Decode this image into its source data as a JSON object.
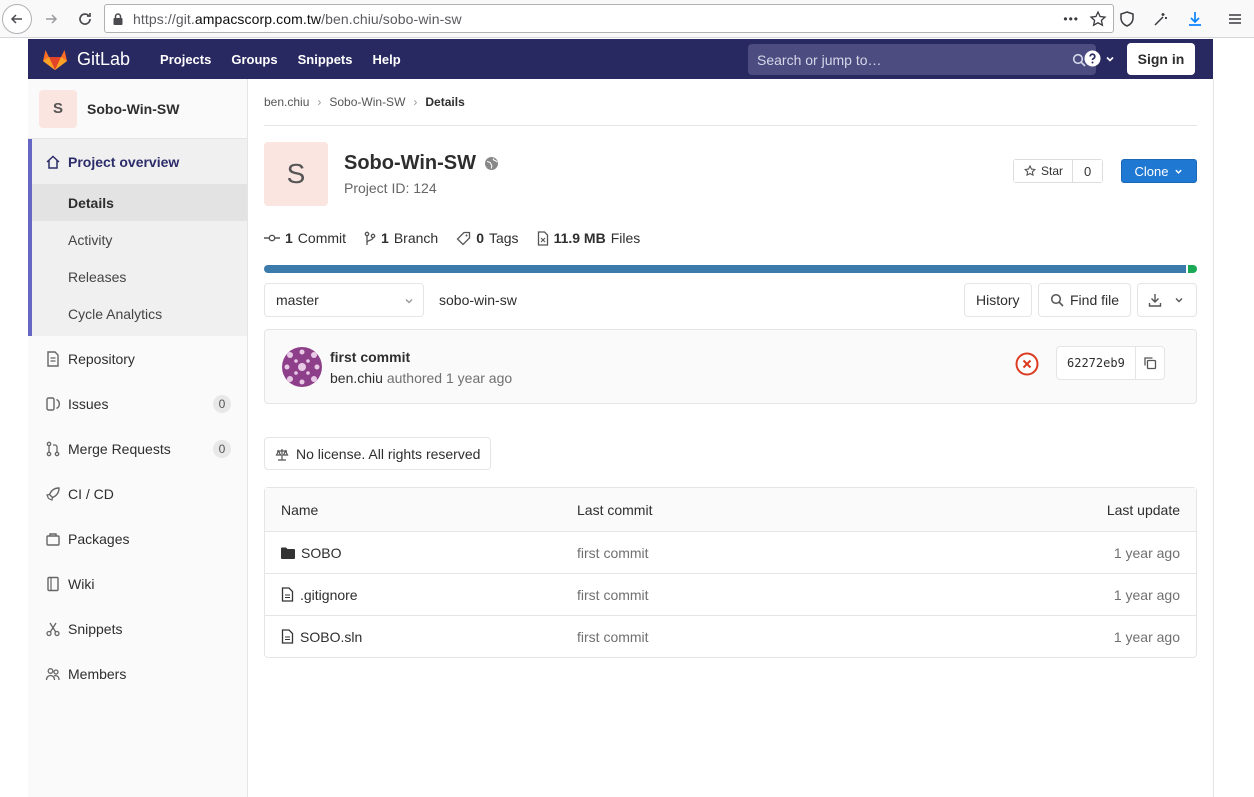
{
  "browser": {
    "url_prefix": "https://git.",
    "url_domain": "ampacscorp.com.tw",
    "url_path": "/ben.chiu/sobo-win-sw",
    "more": "•••"
  },
  "header": {
    "logo_text": "GitLab",
    "nav": [
      "Projects",
      "Groups",
      "Snippets",
      "Help"
    ],
    "search_placeholder": "Search or jump to…",
    "signin_label": "Sign in"
  },
  "sidebar": {
    "project_initial": "S",
    "project_name": "Sobo-Win-SW",
    "overview_label": "Project overview",
    "overview_sub": [
      "Details",
      "Activity",
      "Releases",
      "Cycle Analytics"
    ],
    "items": [
      {
        "label": "Repository",
        "icon": "doc-icon"
      },
      {
        "label": "Issues",
        "icon": "issues-icon",
        "badge": "0"
      },
      {
        "label": "Merge Requests",
        "icon": "merge-icon",
        "badge": "0"
      },
      {
        "label": "CI / CD",
        "icon": "rocket-icon"
      },
      {
        "label": "Packages",
        "icon": "package-icon"
      },
      {
        "label": "Wiki",
        "icon": "book-icon"
      },
      {
        "label": "Snippets",
        "icon": "scissors-icon"
      },
      {
        "label": "Members",
        "icon": "users-icon"
      }
    ]
  },
  "breadcrumb": [
    "ben.chiu",
    "Sobo-Win-SW",
    "Details"
  ],
  "project": {
    "initial": "S",
    "title": "Sobo-Win-SW",
    "id_text": "Project ID: 124",
    "star_label": "Star",
    "star_count": "0",
    "clone_label": "Clone"
  },
  "stats": [
    {
      "num": "1",
      "label": "Commit",
      "icon": "commit-icon"
    },
    {
      "num": "1",
      "label": "Branch",
      "icon": "branch-icon"
    },
    {
      "num": "0",
      "label": "Tags",
      "icon": "tag-icon"
    },
    {
      "num": "11.9 MB",
      "label": "Files",
      "icon": "file-size-icon"
    }
  ],
  "languages": [
    {
      "share": 0.99,
      "color": "#3a7bab"
    },
    {
      "share": 0.01,
      "color": "#1aaa55"
    }
  ],
  "tree": {
    "branch": "master",
    "path": "sobo-win-sw",
    "history_label": "History",
    "find_file_label": "Find file"
  },
  "commit": {
    "title": "first commit",
    "author": "ben.chiu",
    "authored": "authored 1 year ago",
    "sha": "62272eb9"
  },
  "license_label": "No license. All rights reserved",
  "files": {
    "headers": [
      "Name",
      "Last commit",
      "Last update"
    ],
    "rows": [
      {
        "name": "SOBO",
        "type": "folder",
        "commit": "first commit",
        "update": "1 year ago"
      },
      {
        "name": ".gitignore",
        "type": "file",
        "commit": "first commit",
        "update": "1 year ago"
      },
      {
        "name": "SOBO.sln",
        "type": "file",
        "commit": "first commit",
        "update": "1 year ago"
      }
    ]
  }
}
